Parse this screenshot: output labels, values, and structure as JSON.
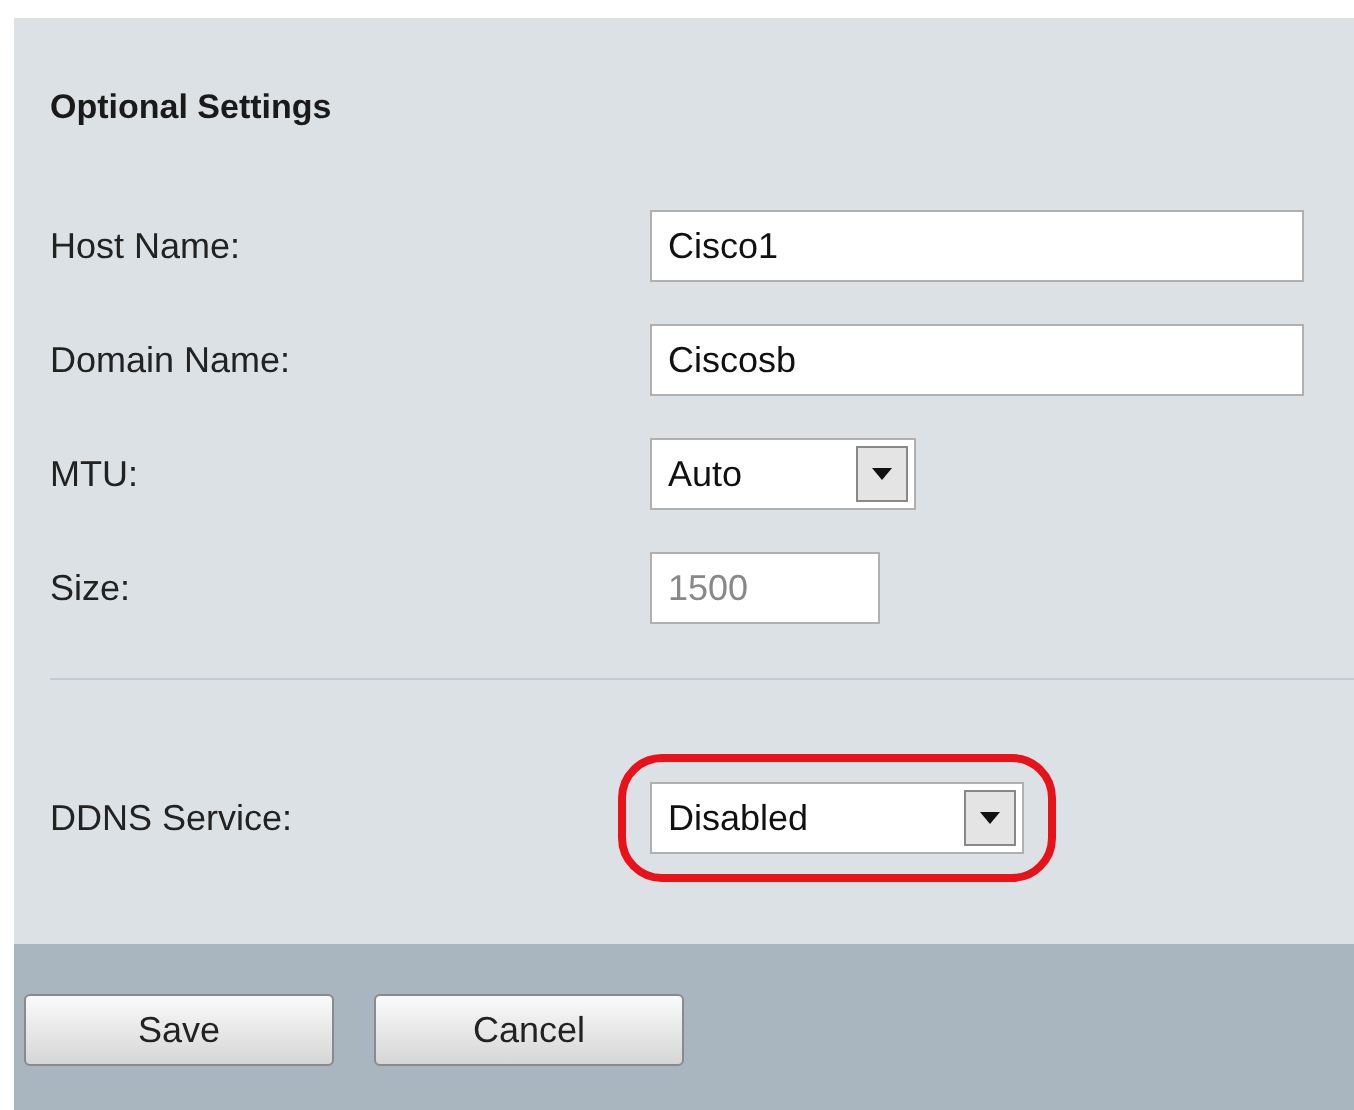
{
  "section": {
    "title": "Optional Settings"
  },
  "fields": [
    {
      "label": "Host Name:",
      "kind": "text",
      "value": "Cisco1",
      "disabled": false
    },
    {
      "label": "Domain Name:",
      "kind": "text",
      "value": "Ciscosb",
      "disabled": false
    },
    {
      "label": "MTU:",
      "kind": "select",
      "value": "Auto",
      "disabled": false
    },
    {
      "label": "Size:",
      "kind": "text",
      "value": "1500",
      "disabled": true
    }
  ],
  "ddns": {
    "label": "DDNS Service:",
    "kind": "select",
    "value": "Disabled",
    "disabled": false,
    "highlighted": true
  },
  "buttons": [
    "Save",
    "Cancel"
  ]
}
